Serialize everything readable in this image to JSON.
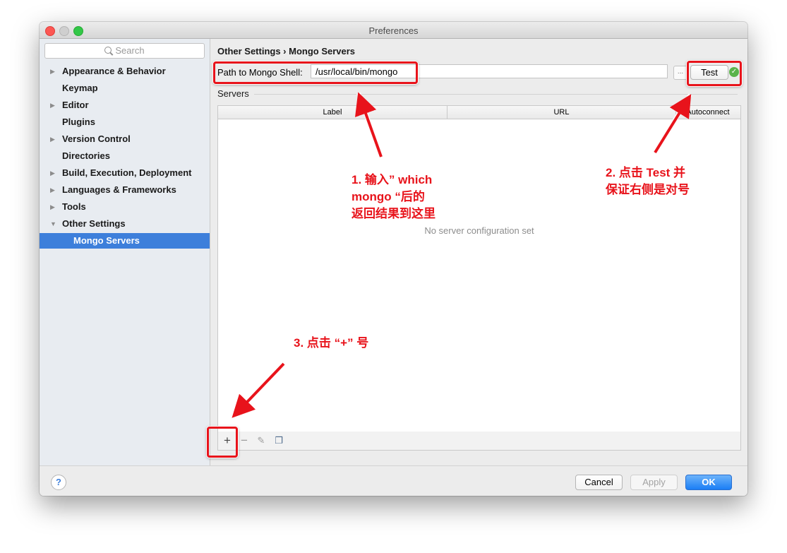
{
  "window": {
    "title": "Preferences"
  },
  "sidebar": {
    "search_placeholder": "Search",
    "items": [
      {
        "label": "Appearance & Behavior",
        "arrow": "▶"
      },
      {
        "label": "Keymap",
        "arrow": ""
      },
      {
        "label": "Editor",
        "arrow": "▶"
      },
      {
        "label": "Plugins",
        "arrow": ""
      },
      {
        "label": "Version Control",
        "arrow": "▶"
      },
      {
        "label": "Directories",
        "arrow": ""
      },
      {
        "label": "Build, Execution, Deployment",
        "arrow": "▶"
      },
      {
        "label": "Languages & Frameworks",
        "arrow": "▶"
      },
      {
        "label": "Tools",
        "arrow": "▶"
      },
      {
        "label": "Other Settings",
        "arrow": "▼"
      },
      {
        "label": "Mongo Servers",
        "arrow": ""
      }
    ]
  },
  "main": {
    "breadcrumb": "Other Settings › Mongo Servers",
    "path_label": "Path to Mongo Shell:",
    "path_value": "/usr/local/bin/mongo",
    "browse_label": "...",
    "test_label": "Test",
    "test_status_icon": "check-circle",
    "servers_label": "Servers",
    "table": {
      "columns": [
        "Label",
        "URL",
        "Autoconnect"
      ],
      "empty_text": "No server configuration set"
    },
    "toolbar": {
      "add": "+",
      "remove": "−"
    }
  },
  "footer": {
    "help": "?",
    "cancel": "Cancel",
    "apply": "Apply",
    "ok": "OK"
  },
  "annotations": {
    "note1": [
      "1. 输入” which",
      "mongo “后的",
      "返回结果到这里"
    ],
    "note2": [
      "2. 点击 Test 并",
      "保证右侧是对号"
    ],
    "note3": "3. 点击 “+” 号",
    "color": "#e8131b"
  }
}
